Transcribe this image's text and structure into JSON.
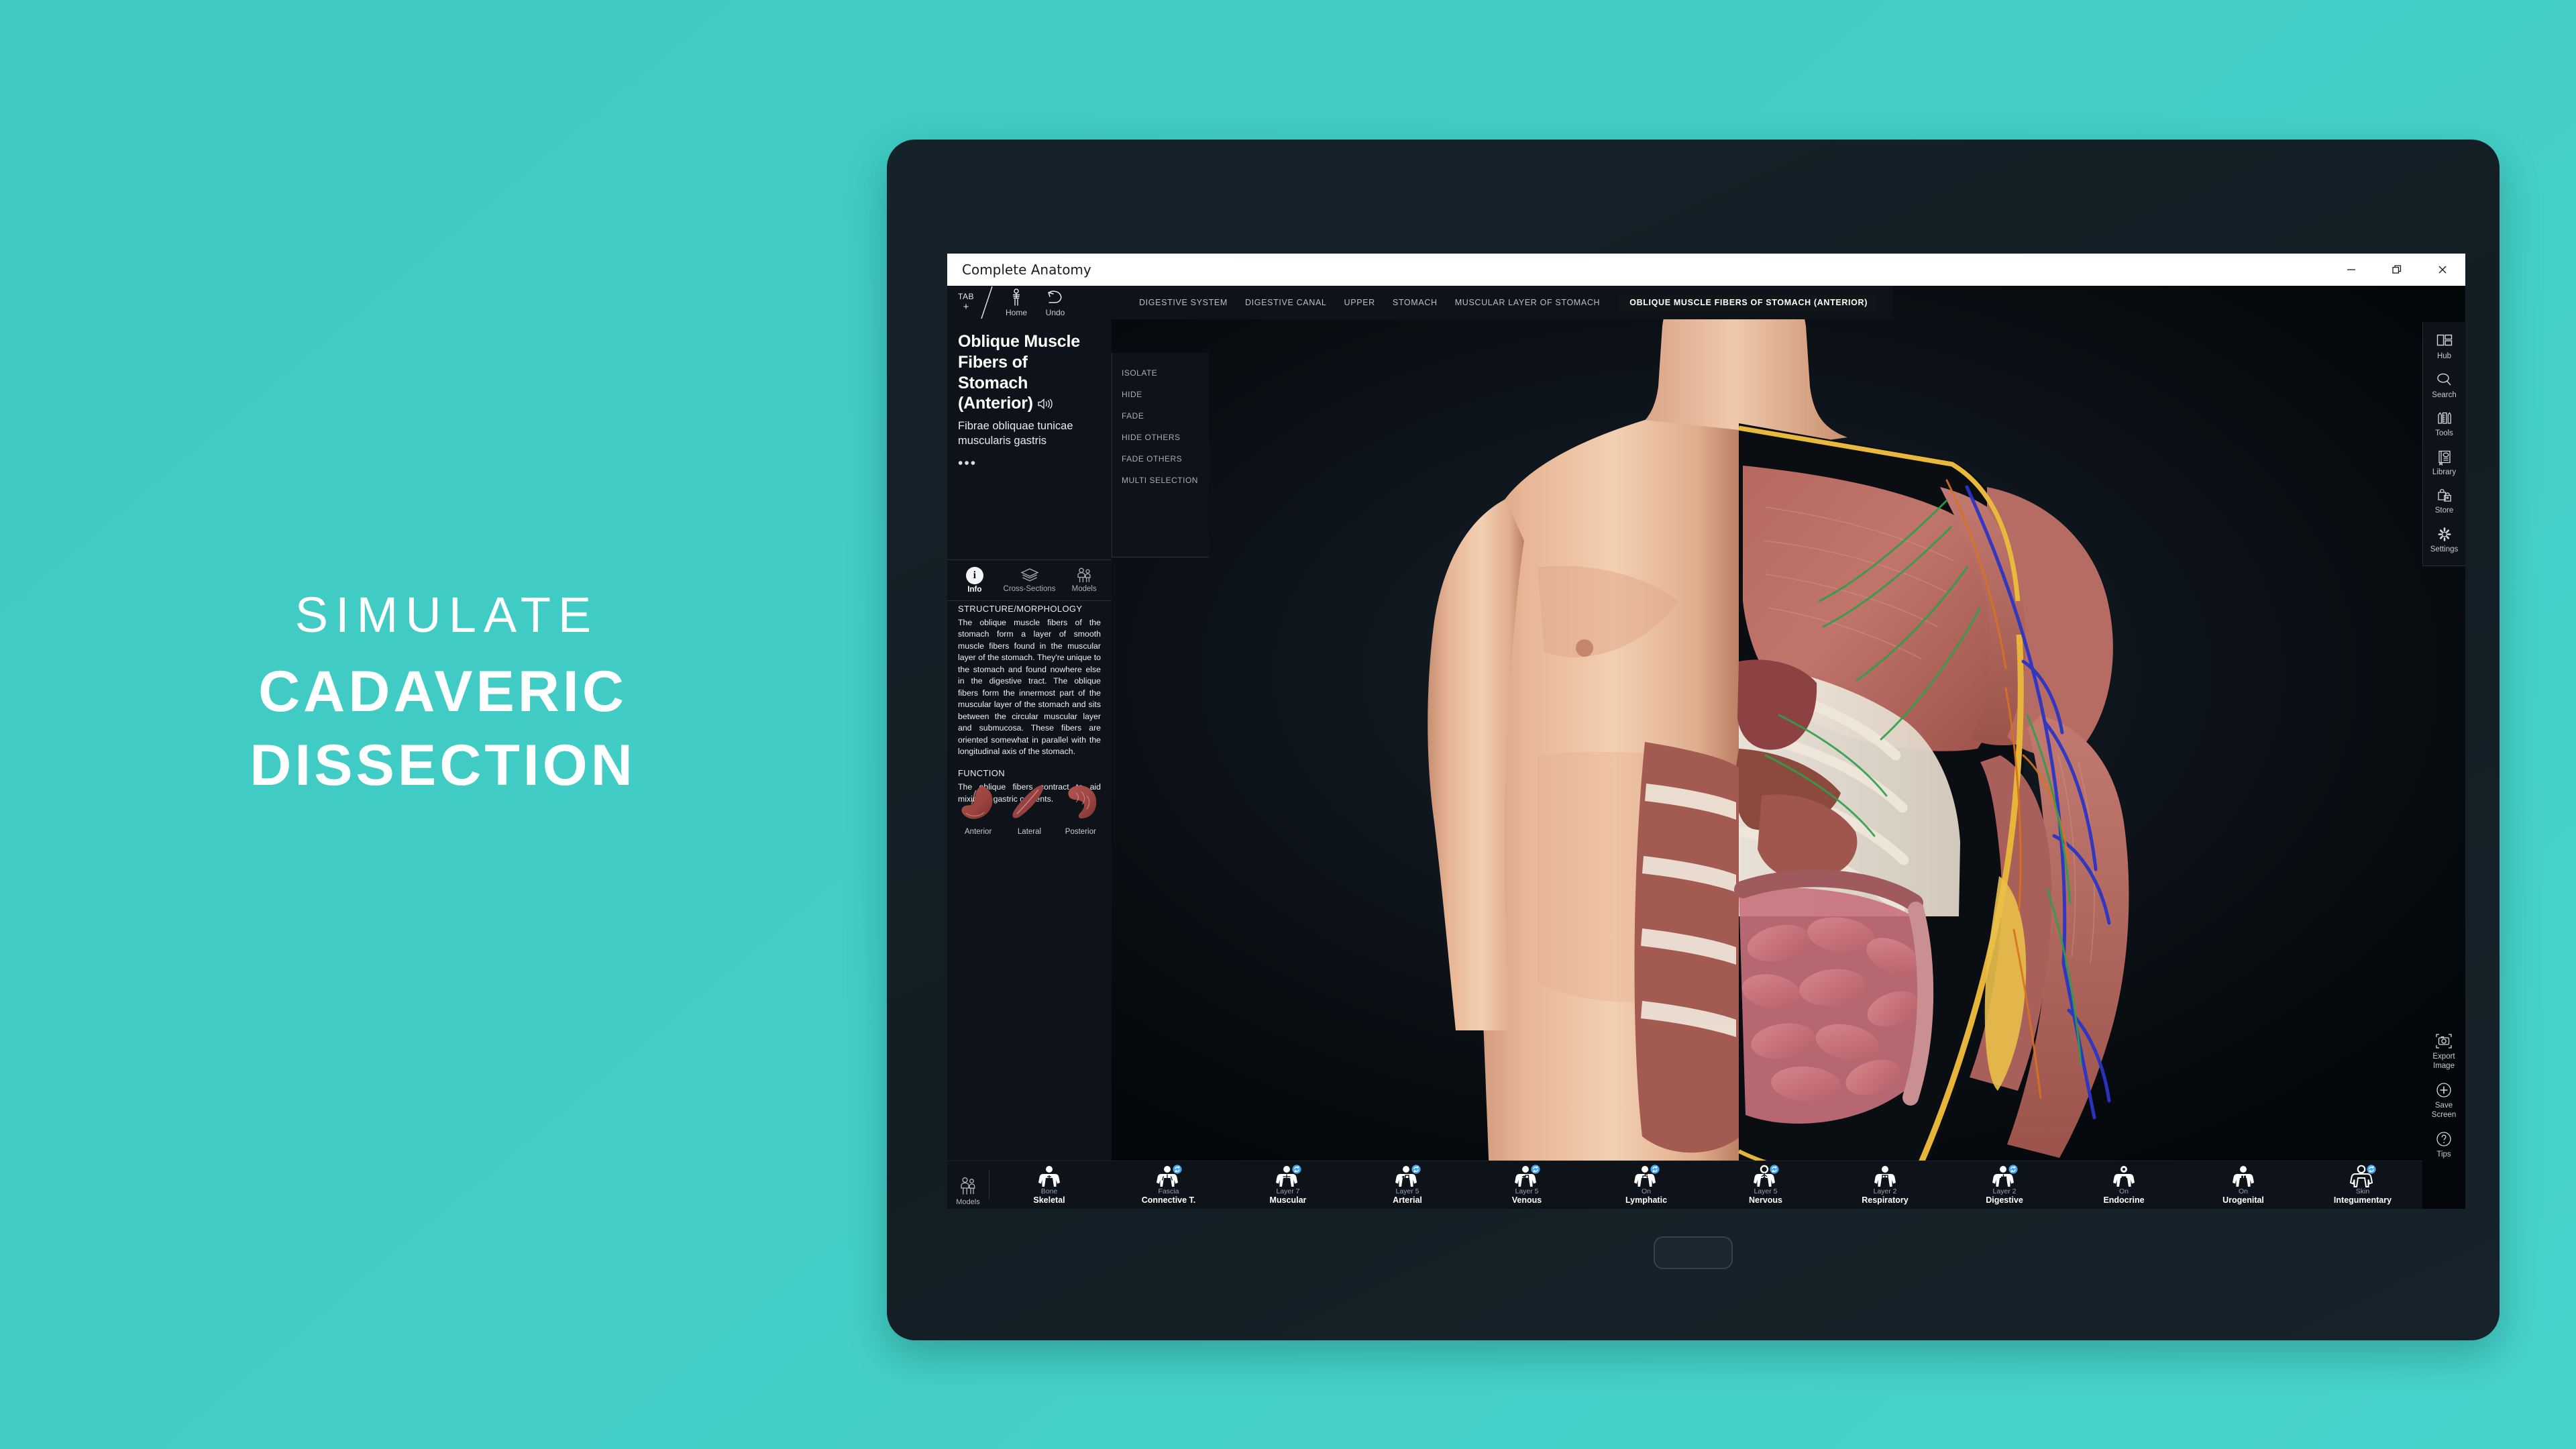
{
  "promo": {
    "line1": "SIMULATE",
    "line2": "CADAVERIC",
    "line3": "DISSECTION",
    "background_color": "#41cdc6",
    "text_color": "#ffffff"
  },
  "window": {
    "title": "Complete Anatomy",
    "controls": {
      "minimize": "minimize",
      "restore": "restore",
      "close": "close"
    }
  },
  "toolbar": {
    "tab_label": "TAB",
    "tab_plus": "+",
    "home_label": "Home",
    "undo_label": "Undo"
  },
  "breadcrumb": [
    {
      "label": "DIGESTIVE SYSTEM",
      "active": false
    },
    {
      "label": "DIGESTIVE CANAL",
      "active": false
    },
    {
      "label": "UPPER",
      "active": false
    },
    {
      "label": "STOMACH",
      "active": false
    },
    {
      "label": "MUSCULAR LAYER OF STOMACH",
      "active": false
    },
    {
      "label": "OBLIQUE MUSCLE FIBERS OF STOMACH (ANTERIOR)",
      "active": true
    }
  ],
  "info_panel": {
    "title": "Oblique Muscle Fibers of Stomach (Anterior)",
    "latin_name": "Fibrae obliquae tunicae muscularis gastris",
    "more_dots": "•••",
    "speaker_icon": "speaker-icon",
    "actions": [
      "ISOLATE",
      "HIDE",
      "FADE",
      "HIDE OTHERS",
      "FADE OTHERS",
      "MULTI SELECTION"
    ],
    "tabs": [
      {
        "label": "Info",
        "icon": "info-icon",
        "selected": true
      },
      {
        "label": "Cross-Sections",
        "icon": "layers-icon",
        "selected": false
      },
      {
        "label": "Models",
        "icon": "people-icon",
        "selected": false
      }
    ],
    "sections": [
      {
        "heading": "STRUCTURE/MORPHOLOGY",
        "body": "The oblique muscle fibers of the stomach form a layer of smooth muscle fibers found in the muscular layer of the stomach. They're unique to the stomach and found nowhere else in the digestive tract. The oblique fibers form the innermost part of the muscular layer of the stomach and sits between the circular muscular layer and submucosa. These fibers are oriented somewhat in parallel with the longitudinal axis of the stomach."
      },
      {
        "heading": "FUNCTION",
        "body": "The oblique fibers contract to aid mixing of gastric contents."
      }
    ],
    "thumbnails": [
      {
        "caption": "Anterior"
      },
      {
        "caption": "Lateral"
      },
      {
        "caption": "Posterior"
      }
    ]
  },
  "right_rail": {
    "top_items": [
      {
        "label": "Hub",
        "icon": "hub-icon"
      },
      {
        "label": "Search",
        "icon": "search-icon"
      },
      {
        "label": "Tools",
        "icon": "tools-icon"
      },
      {
        "label": "Library",
        "icon": "library-icon"
      },
      {
        "label": "Store",
        "icon": "store-icon"
      },
      {
        "label": "Settings",
        "icon": "gear-icon"
      }
    ],
    "bottom_items": [
      {
        "label": "Export Image",
        "icon": "camera-icon"
      },
      {
        "label": "Save Screen",
        "icon": "plus-circle-icon"
      },
      {
        "label": "Tips",
        "icon": "question-circle-icon"
      }
    ]
  },
  "system_bar": {
    "models_label": "Models",
    "models_icon": "people-icon",
    "badge_icon": "refresh-icon",
    "badge_color": "#43a8ef",
    "systems": [
      {
        "name": "Skeletal",
        "state": "Bone",
        "badge": false
      },
      {
        "name": "Connective T.",
        "state": "Fascia",
        "badge": true
      },
      {
        "name": "Muscular",
        "state": "Layer 7",
        "badge": true
      },
      {
        "name": "Arterial",
        "state": "Layer 5",
        "badge": true
      },
      {
        "name": "Venous",
        "state": "Layer 5",
        "badge": true
      },
      {
        "name": "Lymphatic",
        "state": "On",
        "badge": true
      },
      {
        "name": "Nervous",
        "state": "Layer 5",
        "badge": true
      },
      {
        "name": "Respiratory",
        "state": "Layer 2",
        "badge": false
      },
      {
        "name": "Digestive",
        "state": "Layer 2",
        "badge": true
      },
      {
        "name": "Endocrine",
        "state": "On",
        "badge": false
      },
      {
        "name": "Urogenital",
        "state": "On",
        "badge": false
      },
      {
        "name": "Integumentary",
        "state": "Skin",
        "badge": true
      }
    ]
  }
}
